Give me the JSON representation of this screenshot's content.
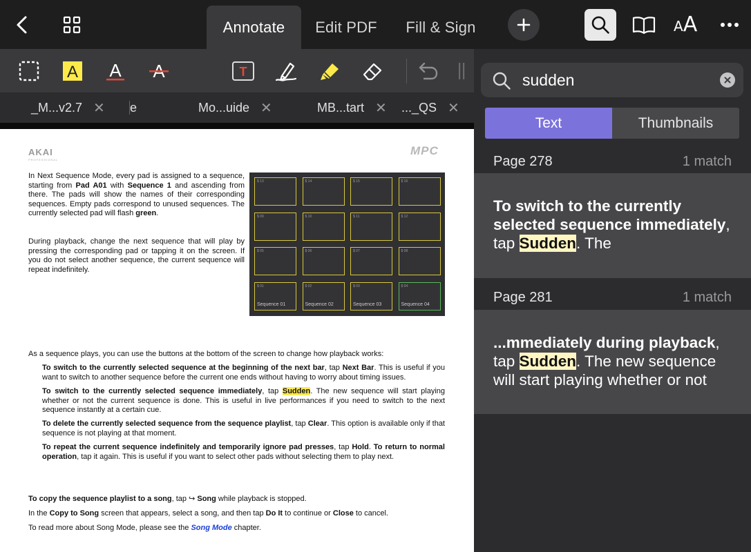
{
  "topbar": {
    "tabs": [
      {
        "label": "Annotate"
      },
      {
        "label": "Edit PDF"
      },
      {
        "label": "Fill & Sign"
      }
    ],
    "text_size_small": "A",
    "text_size_big": "A"
  },
  "doc_tabs": [
    {
      "label": "_M...v2.7"
    },
    {
      "label": "e"
    },
    {
      "label": "Mo...uide"
    },
    {
      "label": "MB...tart"
    },
    {
      "label": "..._QS"
    }
  ],
  "doc_tab_close": "✕",
  "page": {
    "brand": "AKAI",
    "brand_sub": "PROFESSIONAL",
    "product_logo": "MPC",
    "p1": {
      "t1": "In Next Sequence Mode, every pad is assigned to a sequence, starting from ",
      "b1": "Pad A01",
      "t2": " with ",
      "b2": "Sequence 1",
      "t3": " and ascending from there. The pads will show the names of their corresponding sequences. Empty pads correspond to unused sequences. The currently selected pad will flash ",
      "b3": "green",
      "t4": "."
    },
    "p2": "During playback, change the next sequence that will play by pressing the corresponding pad or tapping it on the screen. If you do not select another sequence, the current sequence will repeat indefinitely.",
    "pads": [
      {
        "num": "$ 13",
        "seq": ""
      },
      {
        "num": "$ 14",
        "seq": ""
      },
      {
        "num": "$ 15",
        "seq": ""
      },
      {
        "num": "$ 16",
        "seq": ""
      },
      {
        "num": "$ 09",
        "seq": ""
      },
      {
        "num": "$ 10",
        "seq": ""
      },
      {
        "num": "$ 11",
        "seq": ""
      },
      {
        "num": "$ 12",
        "seq": ""
      },
      {
        "num": "$ 05",
        "seq": ""
      },
      {
        "num": "$ 06",
        "seq": ""
      },
      {
        "num": "$ 07",
        "seq": ""
      },
      {
        "num": "$ 08",
        "seq": ""
      },
      {
        "num": "$ 01",
        "seq": "Sequence 01"
      },
      {
        "num": "$ 02",
        "seq": "Sequence 02"
      },
      {
        "num": "$ 03",
        "seq": "Sequence 03"
      },
      {
        "num": "$ 04",
        "seq": "Sequence 04"
      }
    ],
    "p3": "As a sequence plays, you can use the buttons at the bottom of the screen to change how playback works:",
    "bul1": {
      "b1": "To switch to the currently selected sequence at the beginning of the next bar",
      "t1": ", tap ",
      "b2": "Next Bar",
      "t2": ". This is useful if you want to switch to another sequence before the current one ends without having to worry about timing issues."
    },
    "bul2": {
      "b1": "To switch to the currently selected sequence immediately",
      "t1": ", tap ",
      "hl": "Sudden",
      "t2": ". The new sequence will start playing whether or not the current sequence is done. This is useful in live performances if you need to switch to the next sequence instantly at a certain cue."
    },
    "bul3": {
      "b1": "To delete the currently selected sequence from the sequence playlist",
      "t1": ", tap ",
      "b2": "Clear",
      "t2": ". This option is available only if that sequence is not playing at that moment."
    },
    "bul4": {
      "b1": "To repeat the current sequence indefinitely and temporarily ignore pad presses",
      "t1": ", tap ",
      "b2": "Hold",
      "t2": ". ",
      "b3": "To return to normal operation",
      "t3": ", tap it again. This is useful if you want to select other pads without selecting them to play next."
    },
    "p4": {
      "b1": "To copy the sequence playlist to a song",
      "t1": ", tap ↪ ",
      "b2": "Song",
      "t2": " while playback is stopped."
    },
    "p5": {
      "t1": "In the ",
      "b1": "Copy to Song",
      "t2": " screen that appears, select a song, and then tap ",
      "b2": "Do It",
      "t3": " to continue or ",
      "b3": "Close",
      "t4": " to cancel."
    },
    "p6": {
      "t1": "To read more about Song Mode, please see the ",
      "link": "Song Mode",
      "t2": " chapter."
    }
  },
  "search": {
    "query": "sudden",
    "segments": [
      {
        "label": "Text"
      },
      {
        "label": "Thumbnails"
      }
    ],
    "results": [
      {
        "page": "Page 278",
        "count": "1 match",
        "b1": "To switch to the currently selected sequence immediately",
        "t1": ", tap ",
        "mark": "Sudden",
        "t2": ". The"
      },
      {
        "page": "Page 281",
        "count": "1 match",
        "b1": "...mmediately during playback",
        "t1": ", tap ",
        "mark": "Sudden",
        "t2": ". The new sequence will start playing whether or not"
      }
    ]
  },
  "colors": {
    "accent": "#7c72dc",
    "highlight": "#ffe94d",
    "pad_border": "#d9c93b",
    "pad_selected": "#59b659"
  }
}
